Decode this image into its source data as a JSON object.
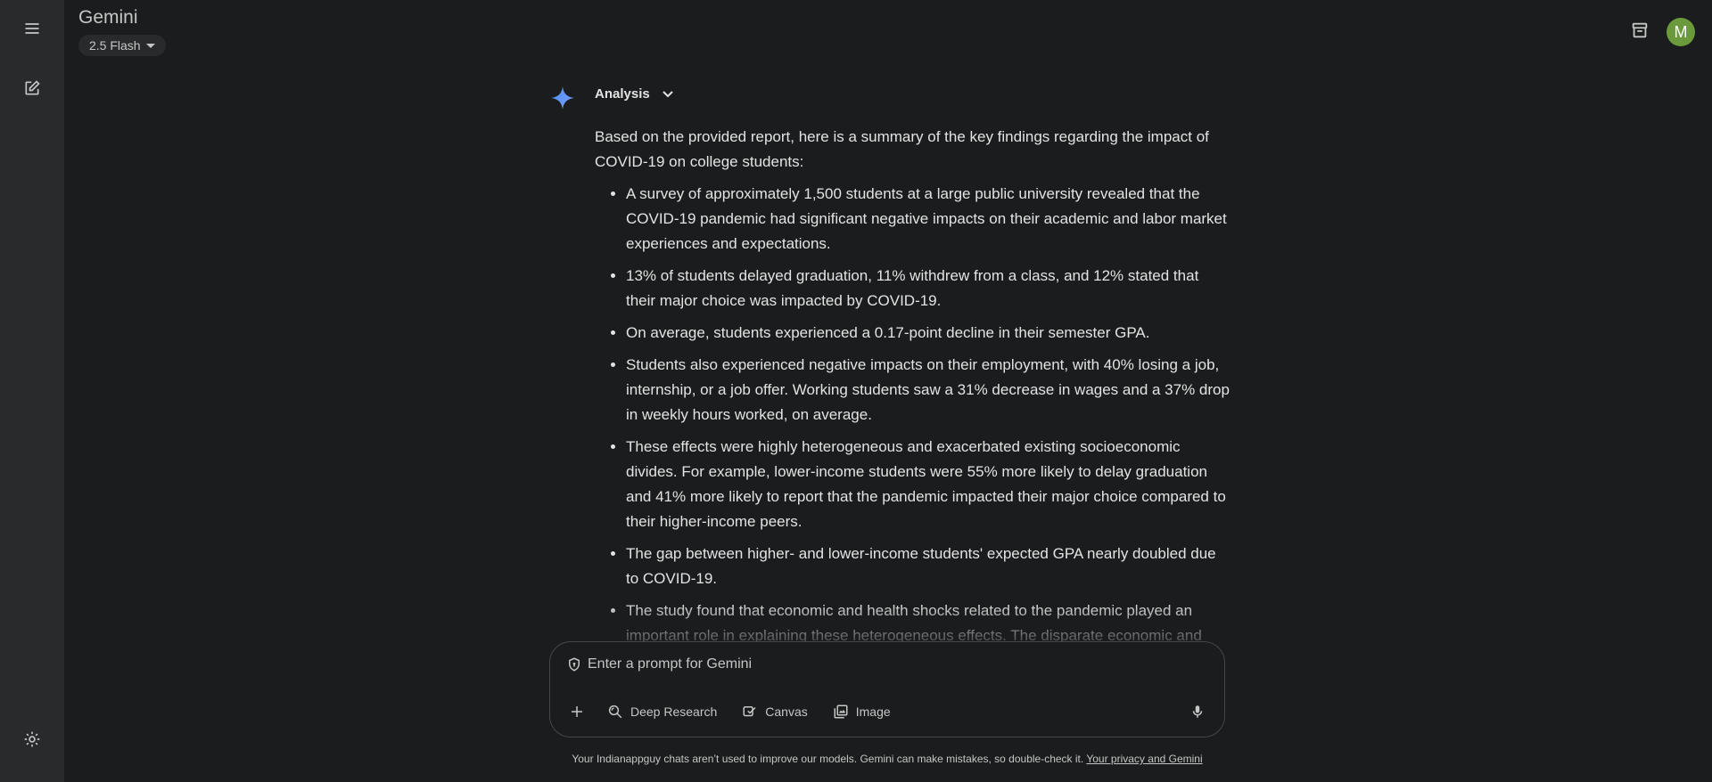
{
  "app": {
    "title": "Gemini",
    "model_label": "2.5 Flash",
    "avatar_letter": "M"
  },
  "rail": {
    "icons": [
      "menu-icon",
      "new-chat-icon",
      "settings-icon"
    ]
  },
  "response": {
    "section_label": "Analysis",
    "intro": "Based on the provided report, here is a summary of the key findings regarding the impact of COVID-19 on college students:",
    "bullets": [
      "A survey of approximately 1,500 students at a large public university revealed that the COVID-19 pandemic had significant negative impacts on their academic and labor market experiences and expectations.",
      "13% of students delayed graduation, 11% withdrew from a class, and 12% stated that their major choice was impacted by COVID-19.",
      "On average, students experienced a 0.17-point decline in their semester GPA.",
      "Students also experienced negative impacts on their employment, with 40% losing a job, internship, or a job offer. Working students saw a 31% decrease in wages and a 37% drop in weekly hours worked, on average.",
      "These effects were highly heterogeneous and exacerbated existing socioeconomic divides. For example, lower-income students were 55% more likely to delay graduation and 41% more likely to report that the pandemic impacted their major choice compared to their higher-income peers.",
      "The gap between higher- and lower-income students' expected GPA nearly doubled due to COVID-19.",
      "The study found that economic and health shocks related to the pandemic played an important role in explaining these heterogeneous effects. The disparate economic and"
    ]
  },
  "prompt": {
    "placeholder": "Enter a prompt for Gemini",
    "tools": {
      "deep_research": "Deep Research",
      "canvas": "Canvas",
      "image": "Image"
    }
  },
  "footer": {
    "disclaimer": "Your Indianappguy chats aren’t used to improve our models. Gemini can make mistakes, so double-check it.",
    "privacy_link": "Your privacy and Gemini"
  },
  "colors": {
    "background": "#1b1c1d",
    "rail": "#282a2c",
    "avatar": "#6a9a3c",
    "text": "#e3e3e3",
    "muted_text": "#c4c7c5"
  }
}
